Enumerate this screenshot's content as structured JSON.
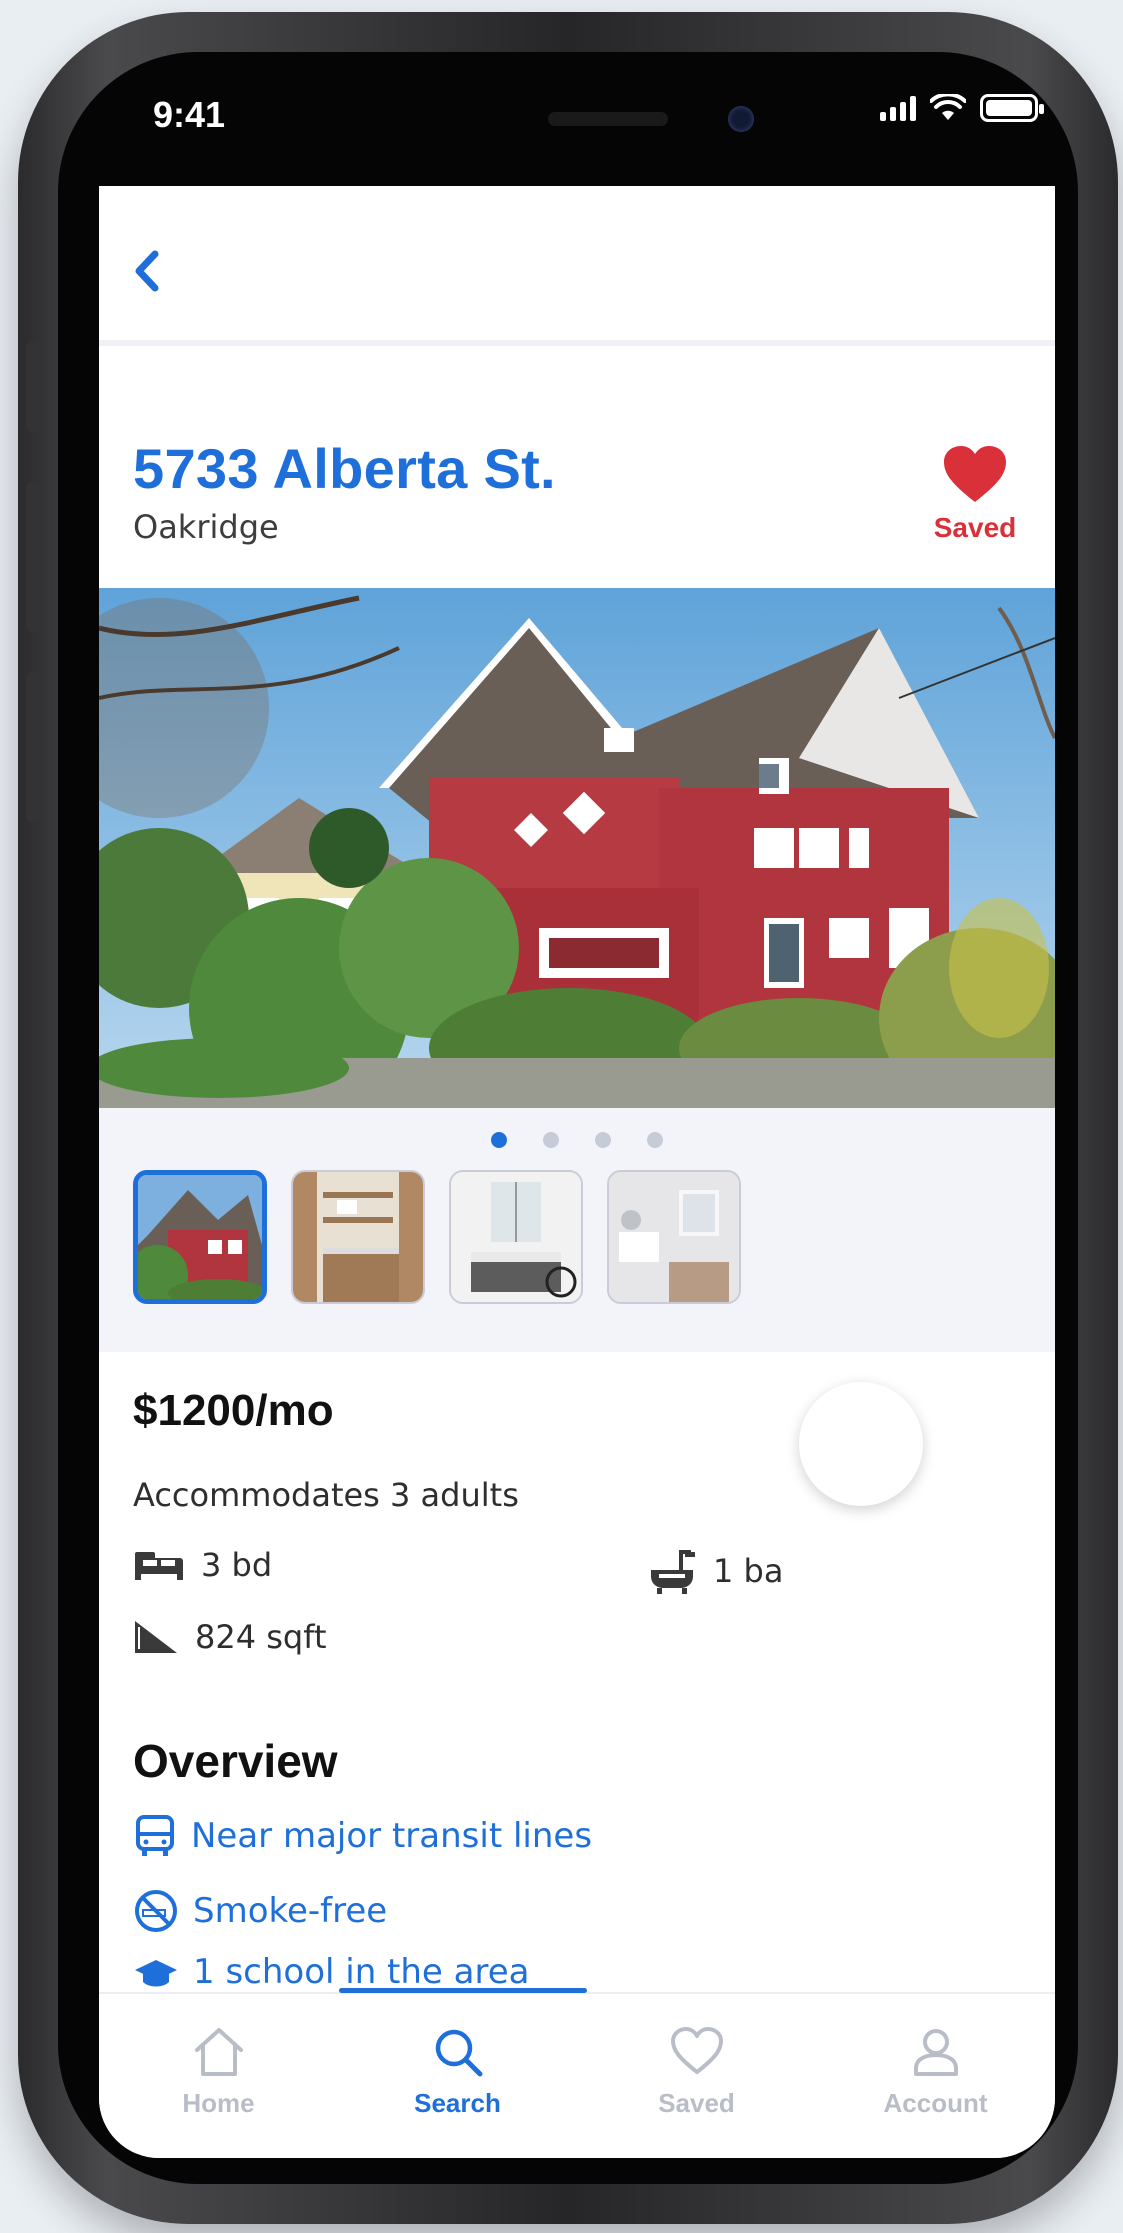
{
  "status_bar": {
    "time": "9:41"
  },
  "listing": {
    "title": "5733 Alberta St.",
    "neighborhood": "Oakridge",
    "saved_label": "Saved",
    "price": "$1200/mo",
    "accommodates": "Accommodates 3 adults",
    "bedrooms": "3 bd",
    "bathrooms": "1 ba",
    "area": "824 sqft"
  },
  "gallery": {
    "photo_count": 4,
    "active_index": 0,
    "thumbnails": [
      "exterior",
      "kitchen",
      "bedroom",
      "bathroom"
    ]
  },
  "overview": {
    "heading": "Overview",
    "items": [
      {
        "icon": "bus-icon",
        "label": "Near major transit lines"
      },
      {
        "icon": "no-smoking-icon",
        "label": "Smoke-free"
      },
      {
        "icon": "graduation-cap-icon",
        "label": "1 school in the area"
      }
    ]
  },
  "tabbar": {
    "active": "Search",
    "tabs": [
      {
        "icon": "home-icon",
        "label": "Home"
      },
      {
        "icon": "search-icon",
        "label": "Search"
      },
      {
        "icon": "heart-icon",
        "label": "Saved"
      },
      {
        "icon": "user-icon",
        "label": "Account"
      }
    ]
  },
  "colors": {
    "accent": "#1e6fd9",
    "saved_red": "#d9303a",
    "text_dark": "#111111",
    "tab_inactive": "#b9bdc8"
  }
}
